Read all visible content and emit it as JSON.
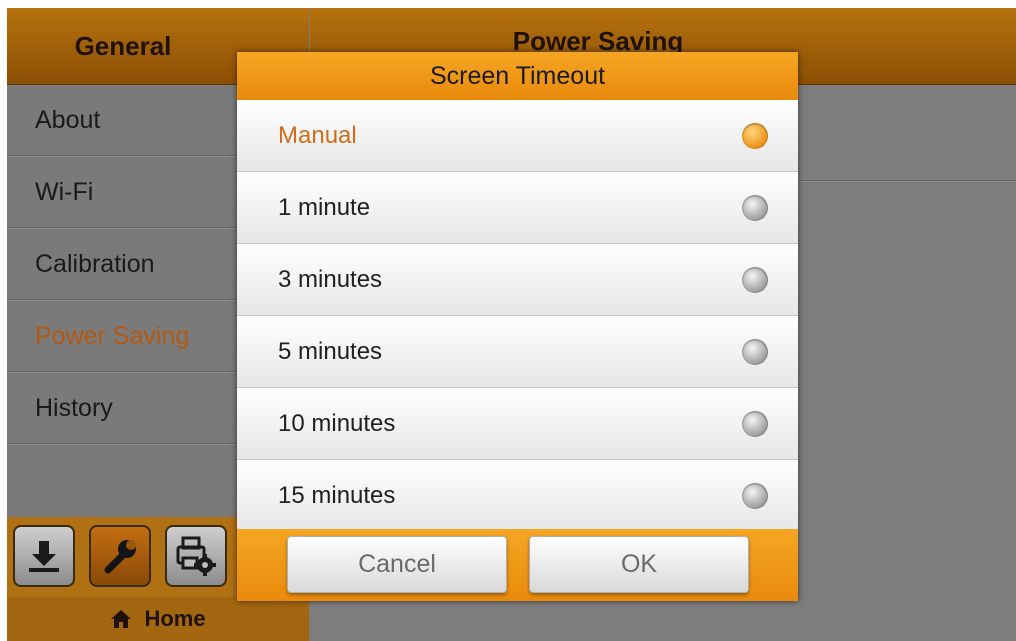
{
  "sidebar": {
    "header": "General",
    "items": [
      {
        "label": "About"
      },
      {
        "label": "Wi-Fi"
      },
      {
        "label": "Calibration"
      },
      {
        "label": "Power Saving",
        "active": true
      },
      {
        "label": "History"
      }
    ],
    "home_label": "Home"
  },
  "content": {
    "header": "Power Saving"
  },
  "dialog": {
    "title": "Screen Timeout",
    "options": [
      {
        "label": "Manual",
        "selected": true
      },
      {
        "label": "1 minute",
        "selected": false
      },
      {
        "label": "3 minutes",
        "selected": false
      },
      {
        "label": "5 minutes",
        "selected": false
      },
      {
        "label": "10 minutes",
        "selected": false
      },
      {
        "label": "15 minutes",
        "selected": false
      }
    ],
    "cancel_label": "Cancel",
    "ok_label": "OK"
  },
  "colors": {
    "accent_orange": "#f39c1f",
    "header_brown": "#a0600a",
    "selected_text": "#d26c1b"
  },
  "icons": [
    "download-icon",
    "wrench-icon",
    "printer-settings-icon",
    "home-icon"
  ]
}
